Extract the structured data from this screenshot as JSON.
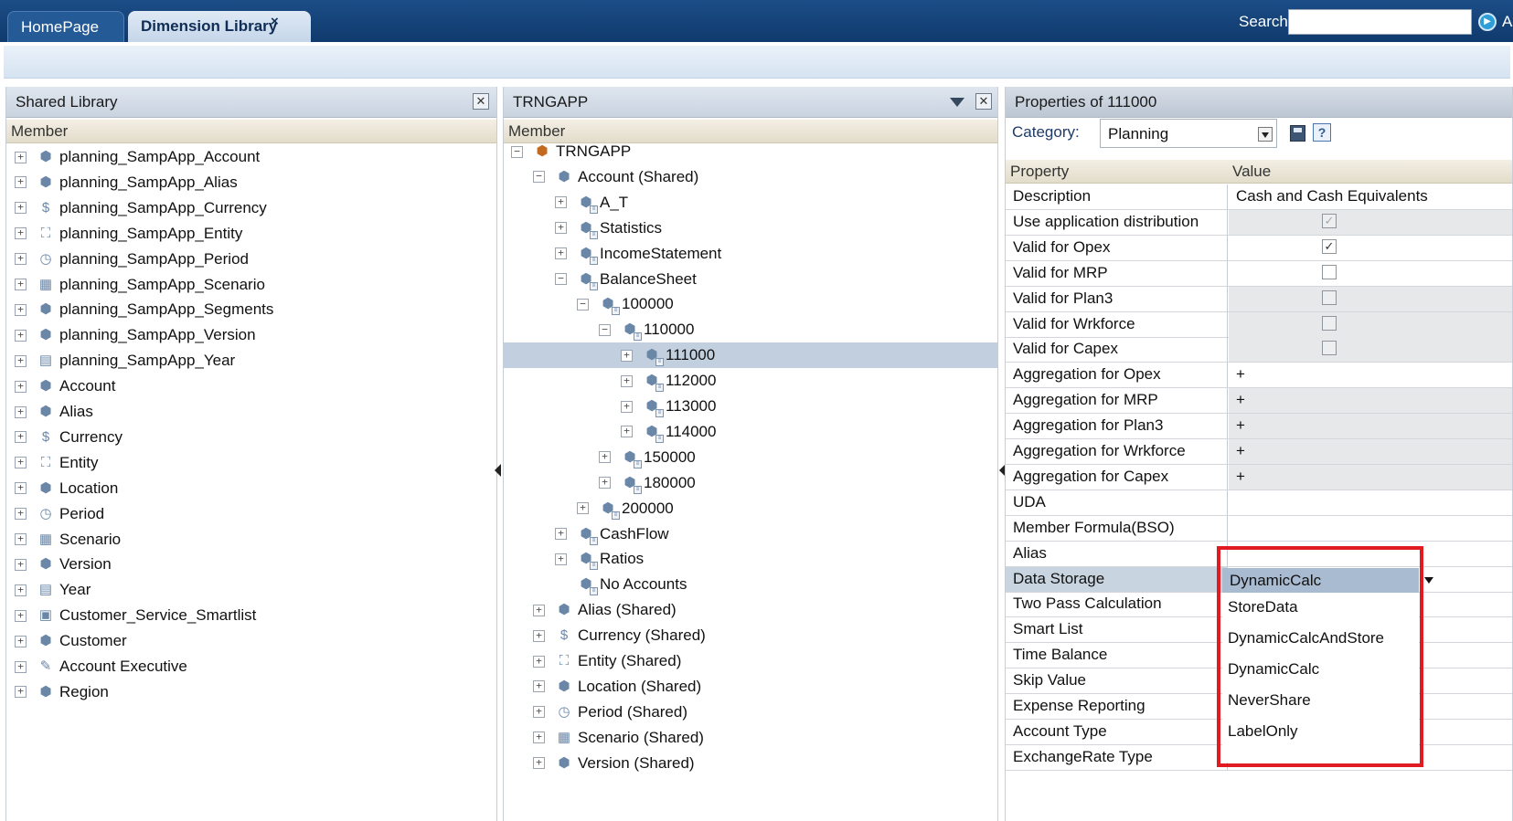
{
  "topbar": {
    "tabs": [
      {
        "label": "HomePage"
      },
      {
        "label": "Dimension Library"
      }
    ],
    "tab_close": "×",
    "search_label": "Search",
    "search_value": "",
    "user_initial": "A"
  },
  "library_panel": {
    "title": "Shared Library",
    "column_header": "Member",
    "items": [
      {
        "label": "planning_SampApp_Account",
        "icon": "account-dimension-icon"
      },
      {
        "label": "planning_SampApp_Alias",
        "icon": "alias-dimension-icon"
      },
      {
        "label": "planning_SampApp_Currency",
        "icon": "currency-dimension-icon"
      },
      {
        "label": "planning_SampApp_Entity",
        "icon": "entity-dimension-icon"
      },
      {
        "label": "planning_SampApp_Period",
        "icon": "period-dimension-icon"
      },
      {
        "label": "planning_SampApp_Scenario",
        "icon": "scenario-dimension-icon"
      },
      {
        "label": "planning_SampApp_Segments",
        "icon": "generic-dimension-icon"
      },
      {
        "label": "planning_SampApp_Version",
        "icon": "version-dimension-icon"
      },
      {
        "label": "planning_SampApp_Year",
        "icon": "year-dimension-icon"
      },
      {
        "label": "Account",
        "icon": "account-dimension-icon"
      },
      {
        "label": "Alias",
        "icon": "alias-dimension-icon"
      },
      {
        "label": "Currency",
        "icon": "currency-dimension-icon"
      },
      {
        "label": "Entity",
        "icon": "entity-dimension-icon"
      },
      {
        "label": "Location",
        "icon": "generic-dimension-icon"
      },
      {
        "label": "Period",
        "icon": "period-dimension-icon"
      },
      {
        "label": "Scenario",
        "icon": "scenario-dimension-icon"
      },
      {
        "label": "Version",
        "icon": "version-dimension-icon"
      },
      {
        "label": "Year",
        "icon": "year-dimension-icon"
      },
      {
        "label": "Customer_Service_Smartlist",
        "icon": "smartlist-dimension-icon"
      },
      {
        "label": "Customer",
        "icon": "generic-dimension-icon"
      },
      {
        "label": "Account Executive",
        "icon": "user-dimension-icon"
      },
      {
        "label": "Region",
        "icon": "version-dimension-icon"
      }
    ]
  },
  "app_panel": {
    "title": "TRNGAPP",
    "column_header": "Member",
    "tree": [
      {
        "label": "TRNGAPP",
        "level": 0,
        "exp": "-",
        "icon": "application-icon"
      },
      {
        "label": "Account (Shared)",
        "level": 1,
        "exp": "-",
        "icon": "account-dimension-icon"
      },
      {
        "label": "A_T",
        "level": 2,
        "exp": "+",
        "icon": "member-icon"
      },
      {
        "label": "Statistics",
        "level": 2,
        "exp": "+",
        "icon": "member-icon"
      },
      {
        "label": "IncomeStatement",
        "level": 2,
        "exp": "+",
        "icon": "member-icon"
      },
      {
        "label": "BalanceSheet",
        "level": 2,
        "exp": "-",
        "icon": "member-icon"
      },
      {
        "label": "100000",
        "level": 3,
        "exp": "-",
        "icon": "member-icon"
      },
      {
        "label": "110000",
        "level": 4,
        "exp": "-",
        "icon": "member-icon"
      },
      {
        "label": "111000",
        "level": 5,
        "exp": "+",
        "icon": "member-icon",
        "selected": true
      },
      {
        "label": "112000",
        "level": 5,
        "exp": "+",
        "icon": "member-icon"
      },
      {
        "label": "113000",
        "level": 5,
        "exp": "+",
        "icon": "member-icon"
      },
      {
        "label": "114000",
        "level": 5,
        "exp": "+",
        "icon": "member-icon"
      },
      {
        "label": "150000",
        "level": 4,
        "exp": "+",
        "icon": "member-icon"
      },
      {
        "label": "180000",
        "level": 4,
        "exp": "+",
        "icon": "member-icon"
      },
      {
        "label": "200000",
        "level": 3,
        "exp": "+",
        "icon": "member-icon"
      },
      {
        "label": "CashFlow",
        "level": 2,
        "exp": "+",
        "icon": "member-icon"
      },
      {
        "label": "Ratios",
        "level": 2,
        "exp": "+",
        "icon": "member-icon"
      },
      {
        "label": "No Accounts",
        "level": 2,
        "exp": "",
        "icon": "member-icon"
      },
      {
        "label": "Alias (Shared)",
        "level": 1,
        "exp": "+",
        "icon": "alias-dimension-icon"
      },
      {
        "label": "Currency (Shared)",
        "level": 1,
        "exp": "+",
        "icon": "currency-dimension-icon"
      },
      {
        "label": "Entity (Shared)",
        "level": 1,
        "exp": "+",
        "icon": "entity-dimension-icon"
      },
      {
        "label": "Location (Shared)",
        "level": 1,
        "exp": "+",
        "icon": "generic-dimension-icon"
      },
      {
        "label": "Period (Shared)",
        "level": 1,
        "exp": "+",
        "icon": "period-dimension-icon"
      },
      {
        "label": "Scenario (Shared)",
        "level": 1,
        "exp": "+",
        "icon": "scenario-dimension-icon"
      },
      {
        "label": "Version (Shared)",
        "level": 1,
        "exp": "+",
        "icon": "version-dimension-icon"
      }
    ]
  },
  "props_panel": {
    "title": "Properties of 111000",
    "category_label": "Category:",
    "category_value": "Planning",
    "col_property": "Property",
    "col_value": "Value",
    "rows": [
      {
        "name": "Description",
        "value": "Cash and Cash Equivalents",
        "grey": false
      },
      {
        "name": "Use application distribution",
        "check": "checked-disabled",
        "grey": true
      },
      {
        "name": "Valid for Opex",
        "check": "checked",
        "grey": false
      },
      {
        "name": "Valid for MRP",
        "check": "unchecked",
        "grey": false
      },
      {
        "name": "Valid for Plan3",
        "check": "unchecked-disabled",
        "grey": true
      },
      {
        "name": "Valid for Wrkforce",
        "check": "unchecked-disabled",
        "grey": true
      },
      {
        "name": "Valid for Capex",
        "check": "unchecked-disabled",
        "grey": true
      },
      {
        "name": "Aggregation for Opex",
        "value": "+",
        "grey": false
      },
      {
        "name": "Aggregation for MRP",
        "value": "+",
        "grey": true
      },
      {
        "name": "Aggregation for Plan3",
        "value": "+",
        "grey": true
      },
      {
        "name": "Aggregation for Wrkforce",
        "value": "+",
        "grey": true
      },
      {
        "name": "Aggregation for Capex",
        "value": "+",
        "grey": true
      },
      {
        "name": "UDA",
        "value": "",
        "grey": false
      },
      {
        "name": "Member Formula(BSO)",
        "value": "",
        "grey": false
      },
      {
        "name": "Alias",
        "value": "",
        "grey": false
      },
      {
        "name": "Data Storage",
        "value": "",
        "grey": false,
        "highlight": true
      },
      {
        "name": "Two Pass Calculation",
        "value": "",
        "grey": false
      },
      {
        "name": "Smart List",
        "value": "",
        "grey": false
      },
      {
        "name": "Time Balance",
        "value": "",
        "grey": false
      },
      {
        "name": "Skip Value",
        "value": "",
        "grey": false
      },
      {
        "name": "Expense Reporting",
        "value": "",
        "grey": false
      },
      {
        "name": "Account Type",
        "value": "",
        "grey": false
      },
      {
        "name": "ExchangeRate Type",
        "value": "",
        "grey": false
      }
    ],
    "data_storage": {
      "selected": "DynamicCalc",
      "options": [
        "StoreData",
        "DynamicCalcAndStore",
        "DynamicCalc",
        "NeverShare",
        "LabelOnly"
      ]
    }
  },
  "colors": {
    "topbar": "#0f3a6d",
    "selection": "#c2cfdf",
    "highlight_box": "#e11b22"
  }
}
